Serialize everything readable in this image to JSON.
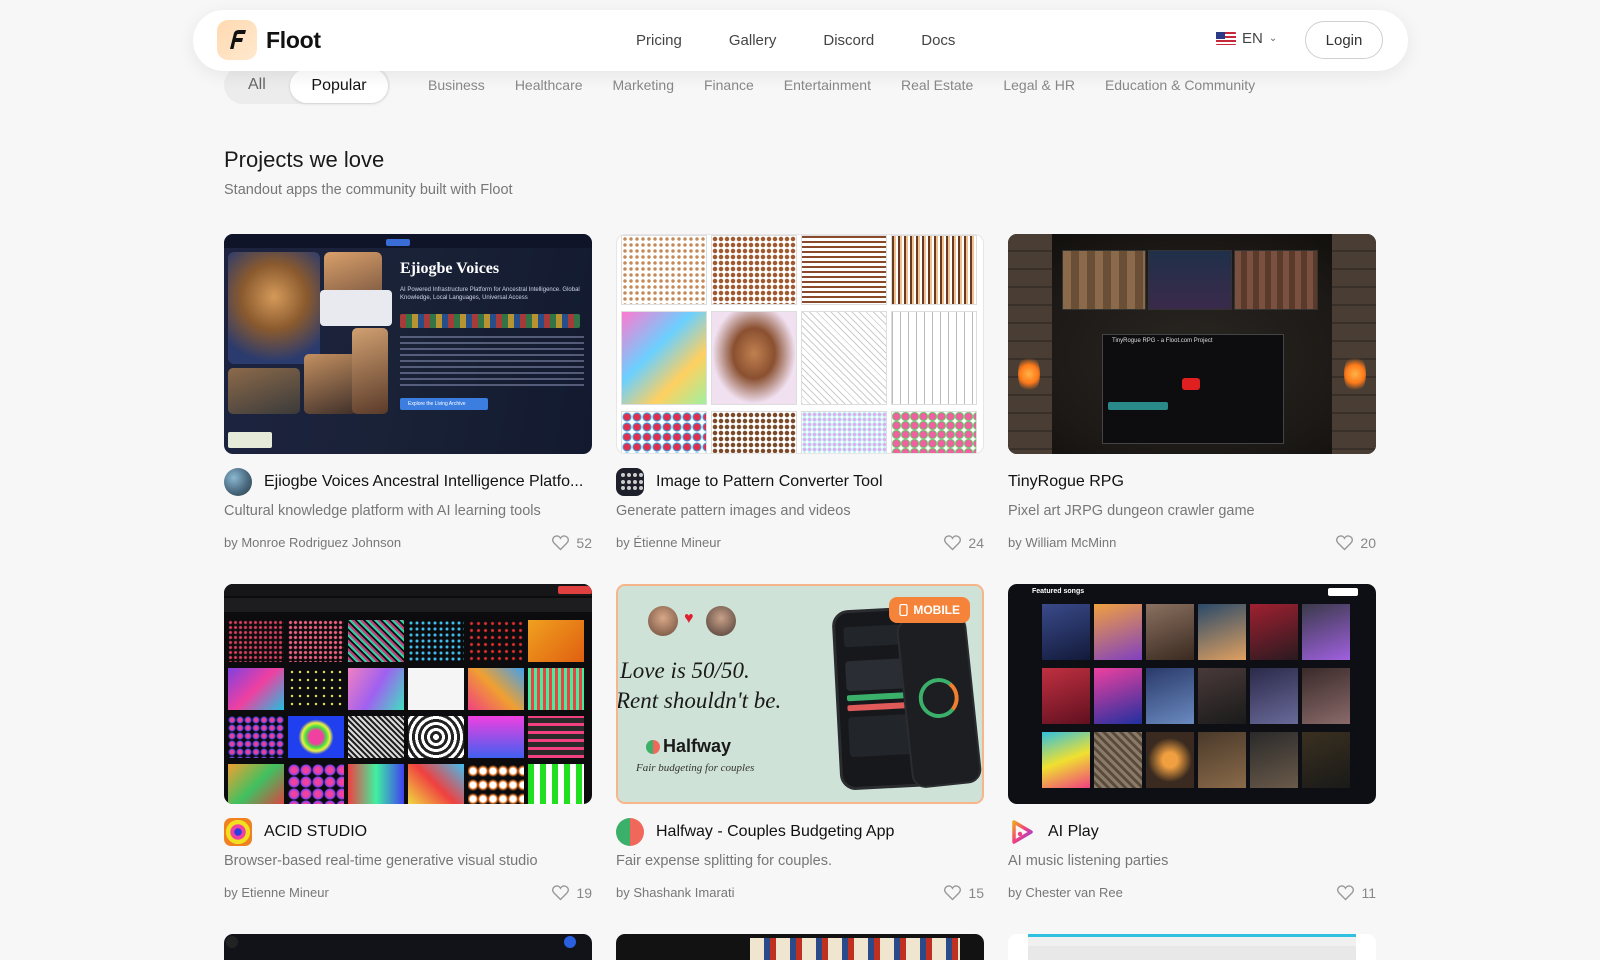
{
  "brand": {
    "name": "Floot"
  },
  "nav": {
    "links": [
      "Pricing",
      "Gallery",
      "Discord",
      "Docs"
    ],
    "language": "EN",
    "login": "Login"
  },
  "filters": {
    "all": "All",
    "popular": "Popular",
    "categories": [
      "Business",
      "Healthcare",
      "Marketing",
      "Finance",
      "Entertainment",
      "Real Estate",
      "Legal & HR",
      "Education & Community"
    ]
  },
  "section": {
    "title": "Projects we love",
    "subtitle": "Standout apps the community built with Floot"
  },
  "projects": [
    {
      "title": "Ejiogbe Voices Ancestral Intelligence Platfo...",
      "description": "Cultural knowledge platform with AI learning tools",
      "author": "by Monroe Rodriguez Johnson",
      "likes": "52",
      "thumb_heading": "Ejiogbe Voices",
      "thumb_sub": "AI Powered Infrastructure Platform for Ancestral Intelligence. Global Knowledge, Local Languages, Universal Access",
      "thumb_button": "Explore the Living Archive"
    },
    {
      "title": "Image to Pattern Converter Tool",
      "description": "Generate pattern images and videos",
      "author": "by Étienne Mineur",
      "likes": "24"
    },
    {
      "title": "TinyRogue RPG",
      "description": "Pixel art JRPG dungeon crawler game",
      "author": "by William McMinn",
      "likes": "20",
      "thumb_video_title": "TinyRogue RPG - a Floot.com Project"
    },
    {
      "title": "ACID STUDIO",
      "description": "Browser-based real-time generative visual studio",
      "author": "by Etienne Mineur",
      "likes": "19"
    },
    {
      "title": "Halfway - Couples Budgeting App",
      "description": "Fair expense splitting for couples.",
      "author": "by Shashank Imarati",
      "likes": "15",
      "badge": "MOBILE",
      "thumb_line1": "Love is 50/50.",
      "thumb_line2": "Rent shouldn't be.",
      "thumb_brand": "Halfway",
      "thumb_tagline": "Fair budgeting for couples"
    },
    {
      "title": "AI Play",
      "description": "AI music listening parties",
      "author": "by Chester van Ree",
      "likes": "11",
      "thumb_heading": "Featured songs"
    }
  ],
  "colors": {
    "accent": "#f5843a",
    "background": "#f7f7f7"
  }
}
